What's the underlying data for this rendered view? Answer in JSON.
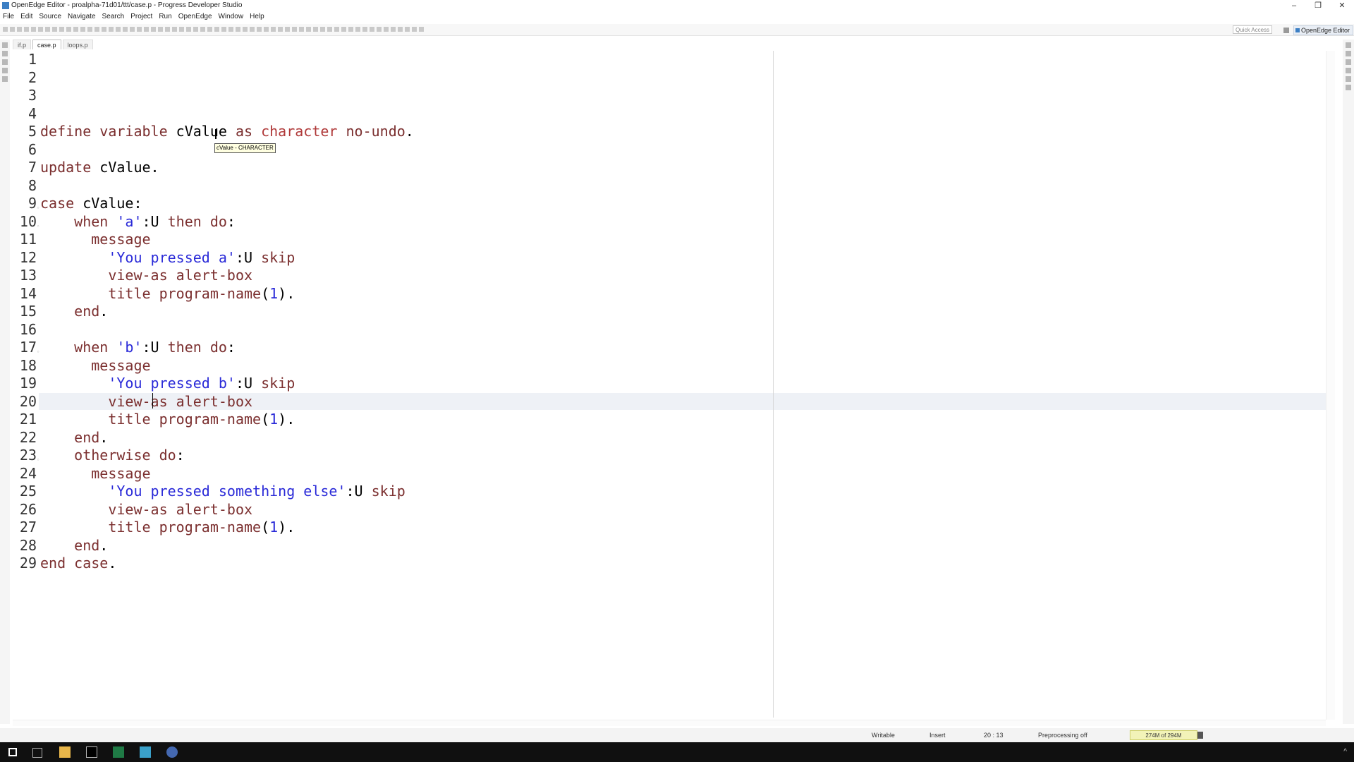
{
  "window": {
    "title": "OpenEdge Editor - proalpha-71d01/ttt/case.p - Progress Developer Studio",
    "minimize_glyph": "–",
    "restore_glyph": "❐",
    "close_glyph": "✕"
  },
  "menu": [
    "File",
    "Edit",
    "Source",
    "Navigate",
    "Search",
    "Project",
    "Run",
    "OpenEdge",
    "Window",
    "Help"
  ],
  "toolbar": {
    "quick_access_placeholder": "Quick Access",
    "perspective_label": "OpenEdge Editor"
  },
  "tabs": [
    {
      "label": "if.p",
      "active": false
    },
    {
      "label": "case.p",
      "active": true
    },
    {
      "label": "loops.p",
      "active": false
    }
  ],
  "tooltip": "cValue - CHARACTER",
  "status": {
    "writable": "Writable",
    "insert_mode": "Insert",
    "position": "20 : 13",
    "preprocessing": "Preprocessing off",
    "memory": "274M of 294M"
  },
  "editor": {
    "current_line": 20,
    "lines": [
      {
        "num": "1",
        "fold": false,
        "tokens": []
      },
      {
        "num": "2",
        "fold": false,
        "tokens": []
      },
      {
        "num": "3",
        "fold": false,
        "tokens": []
      },
      {
        "num": "4",
        "fold": false,
        "tokens": []
      },
      {
        "num": "5",
        "fold": false,
        "tokens": [
          {
            "t": "define variable ",
            "c": "kw"
          },
          {
            "t": "cValue ",
            "c": ""
          },
          {
            "t": "as ",
            "c": "kw"
          },
          {
            "t": "character ",
            "c": "ty"
          },
          {
            "t": "no-undo",
            "c": "kw"
          },
          {
            "t": ".",
            "c": ""
          }
        ]
      },
      {
        "num": "6",
        "fold": false,
        "tokens": []
      },
      {
        "num": "7",
        "fold": false,
        "tokens": [
          {
            "t": "update ",
            "c": "kw"
          },
          {
            "t": "cValue.",
            "c": ""
          }
        ]
      },
      {
        "num": "8",
        "fold": false,
        "tokens": []
      },
      {
        "num": "9",
        "fold": true,
        "tokens": [
          {
            "t": "case ",
            "c": "kw"
          },
          {
            "t": "cValue:",
            "c": ""
          }
        ]
      },
      {
        "num": "10",
        "fold": true,
        "tokens": [
          {
            "t": "    when ",
            "c": "kw"
          },
          {
            "t": "'a'",
            "c": "str"
          },
          {
            "t": ":U ",
            "c": ""
          },
          {
            "t": "then do",
            "c": "kw"
          },
          {
            "t": ":",
            "c": ""
          }
        ]
      },
      {
        "num": "11",
        "fold": false,
        "tokens": [
          {
            "t": "      message",
            "c": "kw"
          }
        ]
      },
      {
        "num": "12",
        "fold": false,
        "tokens": [
          {
            "t": "        'You pressed a'",
            "c": "str"
          },
          {
            "t": ":U ",
            "c": ""
          },
          {
            "t": "skip",
            "c": "kw"
          }
        ]
      },
      {
        "num": "13",
        "fold": false,
        "tokens": [
          {
            "t": "        view-as alert-box",
            "c": "kw"
          }
        ]
      },
      {
        "num": "14",
        "fold": false,
        "tokens": [
          {
            "t": "        title program-name",
            "c": "kw"
          },
          {
            "t": "(",
            "c": ""
          },
          {
            "t": "1",
            "c": "num"
          },
          {
            "t": ").",
            "c": ""
          }
        ]
      },
      {
        "num": "15",
        "fold": false,
        "tokens": [
          {
            "t": "    end",
            "c": "kw"
          },
          {
            "t": ".",
            "c": ""
          }
        ]
      },
      {
        "num": "16",
        "fold": false,
        "tokens": []
      },
      {
        "num": "17",
        "fold": true,
        "tokens": [
          {
            "t": "    when ",
            "c": "kw"
          },
          {
            "t": "'b'",
            "c": "str"
          },
          {
            "t": ":U ",
            "c": ""
          },
          {
            "t": "then do",
            "c": "kw"
          },
          {
            "t": ":",
            "c": ""
          }
        ]
      },
      {
        "num": "18",
        "fold": false,
        "tokens": [
          {
            "t": "      message",
            "c": "kw"
          }
        ]
      },
      {
        "num": "19",
        "fold": false,
        "tokens": [
          {
            "t": "        'You pressed b'",
            "c": "str"
          },
          {
            "t": ":U ",
            "c": ""
          },
          {
            "t": "skip",
            "c": "kw"
          }
        ]
      },
      {
        "num": "20",
        "fold": false,
        "tokens": [
          {
            "t": "        view-as alert-box",
            "c": "kw"
          }
        ]
      },
      {
        "num": "21",
        "fold": false,
        "tokens": [
          {
            "t": "        title program-name",
            "c": "kw"
          },
          {
            "t": "(",
            "c": ""
          },
          {
            "t": "1",
            "c": "num"
          },
          {
            "t": ").",
            "c": ""
          }
        ]
      },
      {
        "num": "22",
        "fold": false,
        "tokens": [
          {
            "t": "    end",
            "c": "kw"
          },
          {
            "t": ".",
            "c": ""
          }
        ]
      },
      {
        "num": "23",
        "fold": true,
        "tokens": [
          {
            "t": "    otherwise do",
            "c": "kw"
          },
          {
            "t": ":",
            "c": ""
          }
        ]
      },
      {
        "num": "24",
        "fold": false,
        "tokens": [
          {
            "t": "      message",
            "c": "kw"
          }
        ]
      },
      {
        "num": "25",
        "fold": false,
        "tokens": [
          {
            "t": "        'You pressed something else'",
            "c": "str"
          },
          {
            "t": ":U ",
            "c": ""
          },
          {
            "t": "skip",
            "c": "kw"
          }
        ]
      },
      {
        "num": "26",
        "fold": false,
        "tokens": [
          {
            "t": "        view-as alert-box",
            "c": "kw"
          }
        ]
      },
      {
        "num": "27",
        "fold": false,
        "tokens": [
          {
            "t": "        title program-name",
            "c": "kw"
          },
          {
            "t": "(",
            "c": ""
          },
          {
            "t": "1",
            "c": "num"
          },
          {
            "t": ").",
            "c": ""
          }
        ]
      },
      {
        "num": "28",
        "fold": false,
        "tokens": [
          {
            "t": "    end",
            "c": "kw"
          },
          {
            "t": ".",
            "c": ""
          }
        ]
      },
      {
        "num": "29",
        "fold": false,
        "tokens": [
          {
            "t": "end case",
            "c": "kw"
          },
          {
            "t": ".",
            "c": ""
          }
        ]
      }
    ]
  },
  "taskbar": {
    "apps": [
      "windows-start-icon",
      "task-view-icon",
      "file-explorer-icon",
      "terminal-icon",
      "excel-icon",
      "calculator-icon",
      "developer-studio-icon"
    ]
  }
}
